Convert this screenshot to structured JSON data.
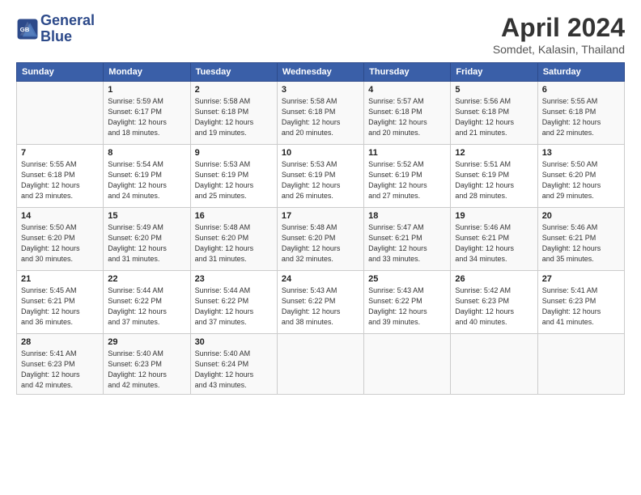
{
  "logo": {
    "line1": "General",
    "line2": "Blue"
  },
  "title": "April 2024",
  "location": "Somdet, Kalasin, Thailand",
  "days_header": [
    "Sunday",
    "Monday",
    "Tuesday",
    "Wednesday",
    "Thursday",
    "Friday",
    "Saturday"
  ],
  "weeks": [
    [
      {
        "num": "",
        "info": ""
      },
      {
        "num": "1",
        "info": "Sunrise: 5:59 AM\nSunset: 6:17 PM\nDaylight: 12 hours\nand 18 minutes."
      },
      {
        "num": "2",
        "info": "Sunrise: 5:58 AM\nSunset: 6:18 PM\nDaylight: 12 hours\nand 19 minutes."
      },
      {
        "num": "3",
        "info": "Sunrise: 5:58 AM\nSunset: 6:18 PM\nDaylight: 12 hours\nand 20 minutes."
      },
      {
        "num": "4",
        "info": "Sunrise: 5:57 AM\nSunset: 6:18 PM\nDaylight: 12 hours\nand 20 minutes."
      },
      {
        "num": "5",
        "info": "Sunrise: 5:56 AM\nSunset: 6:18 PM\nDaylight: 12 hours\nand 21 minutes."
      },
      {
        "num": "6",
        "info": "Sunrise: 5:55 AM\nSunset: 6:18 PM\nDaylight: 12 hours\nand 22 minutes."
      }
    ],
    [
      {
        "num": "7",
        "info": "Sunrise: 5:55 AM\nSunset: 6:18 PM\nDaylight: 12 hours\nand 23 minutes."
      },
      {
        "num": "8",
        "info": "Sunrise: 5:54 AM\nSunset: 6:19 PM\nDaylight: 12 hours\nand 24 minutes."
      },
      {
        "num": "9",
        "info": "Sunrise: 5:53 AM\nSunset: 6:19 PM\nDaylight: 12 hours\nand 25 minutes."
      },
      {
        "num": "10",
        "info": "Sunrise: 5:53 AM\nSunset: 6:19 PM\nDaylight: 12 hours\nand 26 minutes."
      },
      {
        "num": "11",
        "info": "Sunrise: 5:52 AM\nSunset: 6:19 PM\nDaylight: 12 hours\nand 27 minutes."
      },
      {
        "num": "12",
        "info": "Sunrise: 5:51 AM\nSunset: 6:19 PM\nDaylight: 12 hours\nand 28 minutes."
      },
      {
        "num": "13",
        "info": "Sunrise: 5:50 AM\nSunset: 6:20 PM\nDaylight: 12 hours\nand 29 minutes."
      }
    ],
    [
      {
        "num": "14",
        "info": "Sunrise: 5:50 AM\nSunset: 6:20 PM\nDaylight: 12 hours\nand 30 minutes."
      },
      {
        "num": "15",
        "info": "Sunrise: 5:49 AM\nSunset: 6:20 PM\nDaylight: 12 hours\nand 31 minutes."
      },
      {
        "num": "16",
        "info": "Sunrise: 5:48 AM\nSunset: 6:20 PM\nDaylight: 12 hours\nand 31 minutes."
      },
      {
        "num": "17",
        "info": "Sunrise: 5:48 AM\nSunset: 6:20 PM\nDaylight: 12 hours\nand 32 minutes."
      },
      {
        "num": "18",
        "info": "Sunrise: 5:47 AM\nSunset: 6:21 PM\nDaylight: 12 hours\nand 33 minutes."
      },
      {
        "num": "19",
        "info": "Sunrise: 5:46 AM\nSunset: 6:21 PM\nDaylight: 12 hours\nand 34 minutes."
      },
      {
        "num": "20",
        "info": "Sunrise: 5:46 AM\nSunset: 6:21 PM\nDaylight: 12 hours\nand 35 minutes."
      }
    ],
    [
      {
        "num": "21",
        "info": "Sunrise: 5:45 AM\nSunset: 6:21 PM\nDaylight: 12 hours\nand 36 minutes."
      },
      {
        "num": "22",
        "info": "Sunrise: 5:44 AM\nSunset: 6:22 PM\nDaylight: 12 hours\nand 37 minutes."
      },
      {
        "num": "23",
        "info": "Sunrise: 5:44 AM\nSunset: 6:22 PM\nDaylight: 12 hours\nand 37 minutes."
      },
      {
        "num": "24",
        "info": "Sunrise: 5:43 AM\nSunset: 6:22 PM\nDaylight: 12 hours\nand 38 minutes."
      },
      {
        "num": "25",
        "info": "Sunrise: 5:43 AM\nSunset: 6:22 PM\nDaylight: 12 hours\nand 39 minutes."
      },
      {
        "num": "26",
        "info": "Sunrise: 5:42 AM\nSunset: 6:23 PM\nDaylight: 12 hours\nand 40 minutes."
      },
      {
        "num": "27",
        "info": "Sunrise: 5:41 AM\nSunset: 6:23 PM\nDaylight: 12 hours\nand 41 minutes."
      }
    ],
    [
      {
        "num": "28",
        "info": "Sunrise: 5:41 AM\nSunset: 6:23 PM\nDaylight: 12 hours\nand 42 minutes."
      },
      {
        "num": "29",
        "info": "Sunrise: 5:40 AM\nSunset: 6:23 PM\nDaylight: 12 hours\nand 42 minutes."
      },
      {
        "num": "30",
        "info": "Sunrise: 5:40 AM\nSunset: 6:24 PM\nDaylight: 12 hours\nand 43 minutes."
      },
      {
        "num": "",
        "info": ""
      },
      {
        "num": "",
        "info": ""
      },
      {
        "num": "",
        "info": ""
      },
      {
        "num": "",
        "info": ""
      }
    ]
  ]
}
